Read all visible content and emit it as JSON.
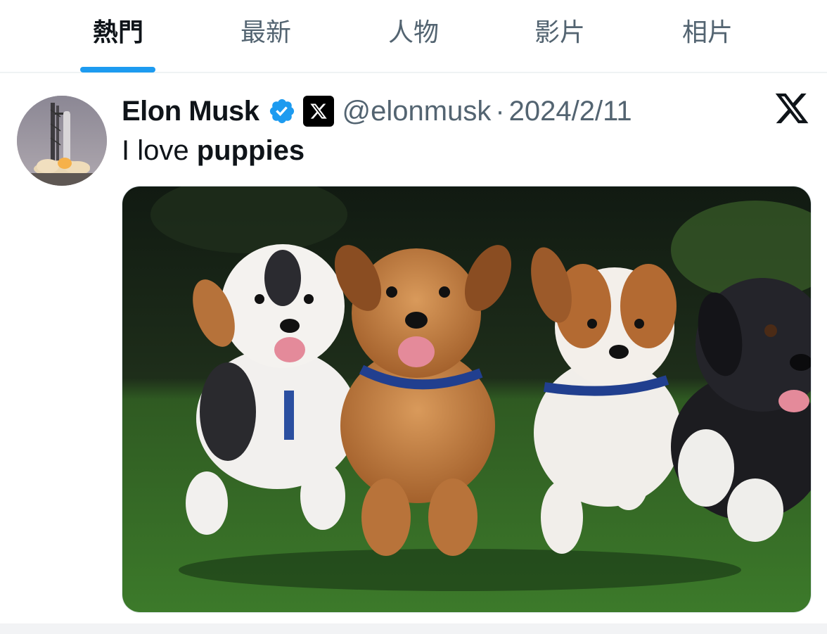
{
  "tabs": [
    {
      "label": "熱門",
      "active": true
    },
    {
      "label": "最新",
      "active": false
    },
    {
      "label": "人物",
      "active": false
    },
    {
      "label": "影片",
      "active": false
    },
    {
      "label": "相片",
      "active": false
    }
  ],
  "tweet": {
    "author_name": "Elon Musk",
    "handle": "@elonmusk",
    "separator": "·",
    "date": "2024/2/11",
    "text_plain": "I love ",
    "text_bold": "puppies",
    "avatar_icon": "rocket-launch-avatar",
    "verified_icon": "verified-badge-icon",
    "affiliate_icon": "x-affiliate-badge-icon",
    "platform_icon": "x-logo-icon",
    "media_icon": "puppies-photo"
  },
  "colors": {
    "accent": "#1d9bf0",
    "text_primary": "#0f1419",
    "text_secondary": "#536471"
  }
}
